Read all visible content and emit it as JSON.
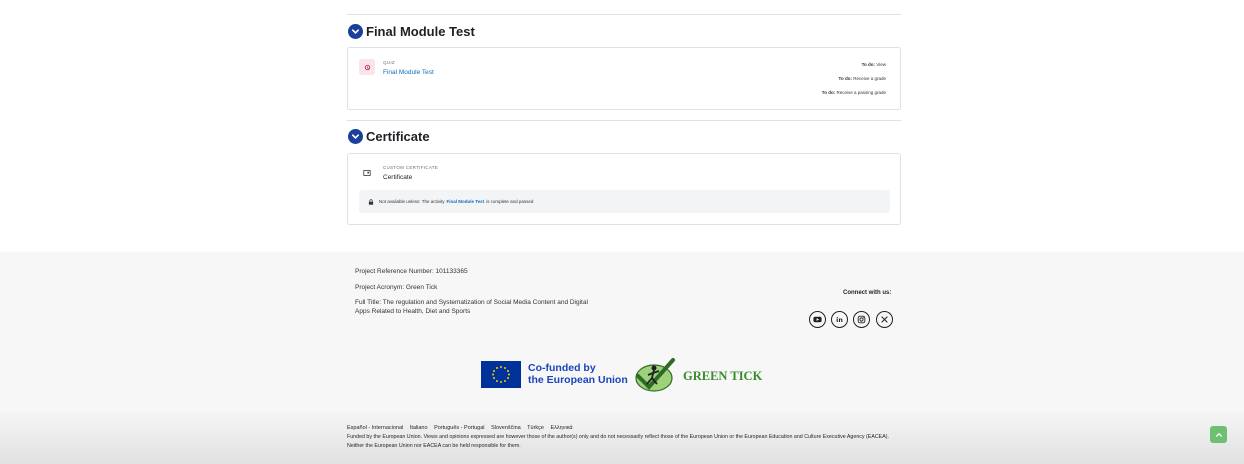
{
  "sections": [
    {
      "title": "Final Module Test",
      "activity": {
        "type_label": "QUIZ",
        "name": "Final Module Test",
        "icon": "quiz-icon",
        "todos": [
          {
            "prefix": "To do:",
            "text": "View"
          },
          {
            "prefix": "To do:",
            "text": "Receive a grade"
          },
          {
            "prefix": "To do:",
            "text": "Receive a passing grade"
          }
        ]
      }
    },
    {
      "title": "Certificate",
      "activity": {
        "type_label": "CUSTOM CERTIFICATE",
        "name": "Certificate",
        "icon": "certificate-icon",
        "restriction": {
          "before": "Not available unless: The activity",
          "link": "Final Module Test",
          "after": "is complete and passed"
        }
      }
    }
  ],
  "footer": {
    "project_reference": "Project Reference Number: 101133365",
    "project_acronym": "Project Acronym: Green Tick",
    "full_title_line1": "Full Title: The regulation and Systematization of Social Media Content and Digital",
    "full_title_line2": "Apps Related to Health, Diet and Sports",
    "connect_label": "Connect with us:",
    "social": [
      "youtube-icon",
      "linkedin-icon",
      "instagram-icon",
      "x-icon"
    ],
    "eu_line1": "Co-funded by",
    "eu_line2": "the European Union",
    "logo_text": "GREEN TICK",
    "languages": [
      "Español - Internacional",
      "Italiano",
      "Português - Portugal",
      "Slovenščina",
      "Türkçe",
      "Ελληνικά"
    ],
    "disclaimer": "Funded by the European Union. Views and opinions expressed are however those of the author(s) only and do not necessarily reflect those of the European Union or the European Education and Culture Executive Agency (EACEA). Neither the European Union nor EACEA can be held responsible for them."
  },
  "colors": {
    "accent": "#1b3f9a",
    "link": "#0f6cbf",
    "green": "#3a8a2e",
    "back_to_top": "#6fbf73"
  }
}
